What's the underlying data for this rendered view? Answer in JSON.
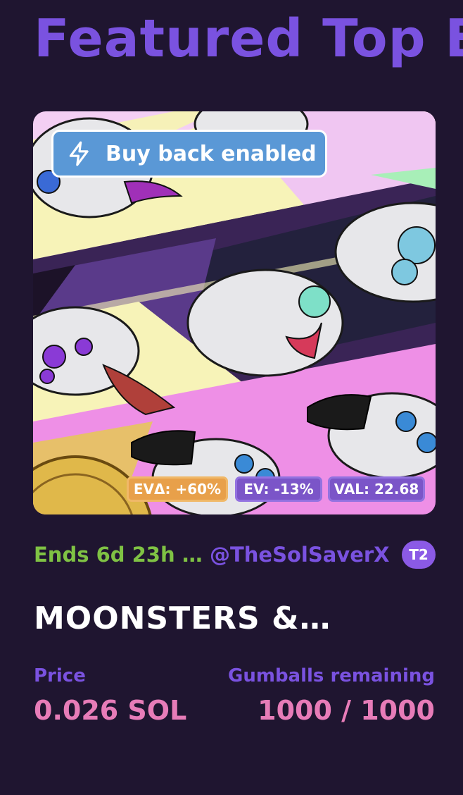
{
  "page": {
    "title": "Featured Top E"
  },
  "listing": {
    "buyback_label": "Buy back enabled",
    "badges": {
      "ev_delta": "EVΔ: +60%",
      "ev": "EV: -13%",
      "val": "VAL: 22.68"
    },
    "ends": "Ends 6d 23h …",
    "creator": "@TheSolSaverX",
    "tier": "T2",
    "name": "MOONSTERS &…",
    "price_label": "Price",
    "price_value": "0.026 SOL",
    "remaining_label": "Gumballs remaining",
    "remaining_value": "1000 / 1000",
    "image_icon": "nft-artwork-image",
    "buyback_icon": "lightning-bolt-icon"
  },
  "colors": {
    "background": "#1f1530",
    "accent_purple": "#7a52e0",
    "ends_green": "#7fc244",
    "price_pink": "#e77cb8",
    "buyback_blue": "#5a98d6"
  }
}
